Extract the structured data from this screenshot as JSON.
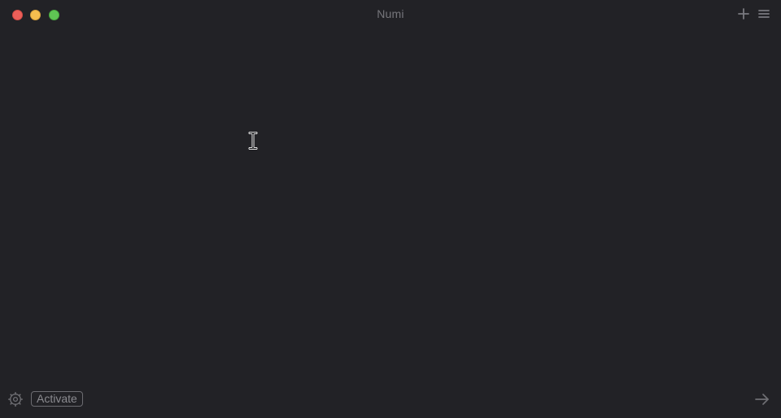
{
  "window": {
    "title": "Numi"
  },
  "toolbar": {
    "add_icon": "plus-icon",
    "menu_icon": "hamburger-menu-icon"
  },
  "editor": {
    "content": "",
    "cursor": "ibeam-cursor-icon"
  },
  "bottombar": {
    "settings_icon": "gear-icon",
    "activate_label": "Activate",
    "forward_icon": "arrow-right-icon"
  },
  "colors": {
    "background": "#222226",
    "close": "#ec5f59",
    "minimize": "#f4bd4f",
    "zoom": "#5fc454",
    "muted_text": "#76767b"
  }
}
